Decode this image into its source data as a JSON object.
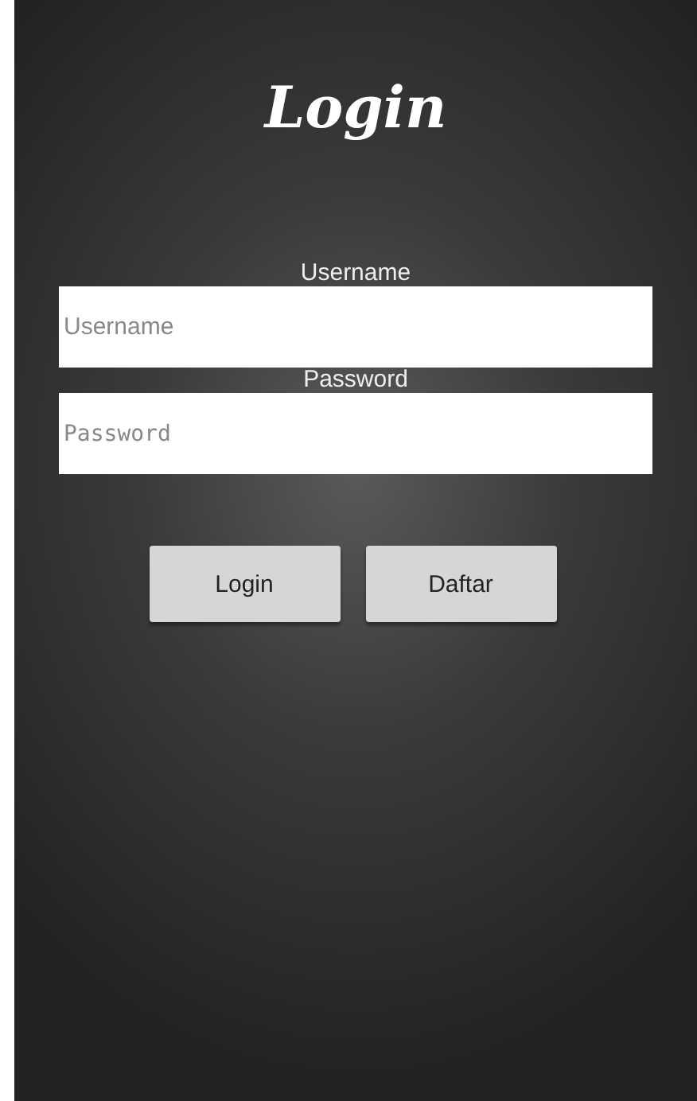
{
  "title": "Login",
  "fields": [
    {
      "label": "Username",
      "placeholder": "Username",
      "kind": "text"
    },
    {
      "label": "Password",
      "placeholder": "Password",
      "kind": "password"
    }
  ],
  "buttons": [
    "Login",
    "Daftar"
  ]
}
